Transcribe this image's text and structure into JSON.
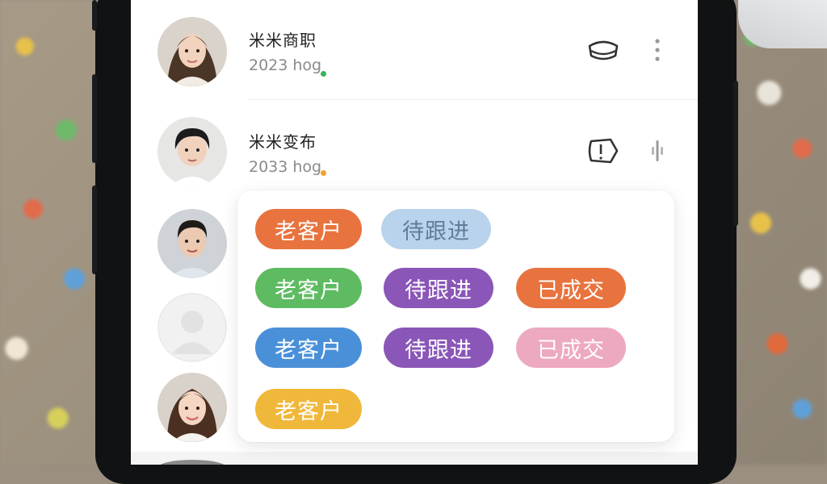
{
  "contacts": [
    {
      "name": "米米商职",
      "sub": "2023 hog",
      "dot_color": "#36b35a"
    },
    {
      "name": "米米变布",
      "sub": "2033 hog",
      "dot_color": "#f0a22e"
    }
  ],
  "icons": {
    "row1_action": "chat-bubble-icon",
    "row1_more": "more-vertical-icon",
    "row2_action": "tag-icon",
    "row2_more": "voice-icon"
  },
  "tags": [
    {
      "label": "老客户",
      "color": "#e8733e"
    },
    {
      "label": "待跟进",
      "color": "#b9d3ec",
      "text_color": "#5d7d9a"
    },
    {
      "label": "老客户",
      "color": "#5fbb62"
    },
    {
      "label": "待跟进",
      "color": "#8a56b8"
    },
    {
      "label": "已成交",
      "color": "#e8733e"
    },
    {
      "label": "老客户",
      "color": "#4a90d9"
    },
    {
      "label": "待跟进",
      "color": "#8a56b8"
    },
    {
      "label": "已成交",
      "color": "#eda9bf"
    },
    {
      "label": "老客户",
      "color": "#f0b83a"
    }
  ]
}
